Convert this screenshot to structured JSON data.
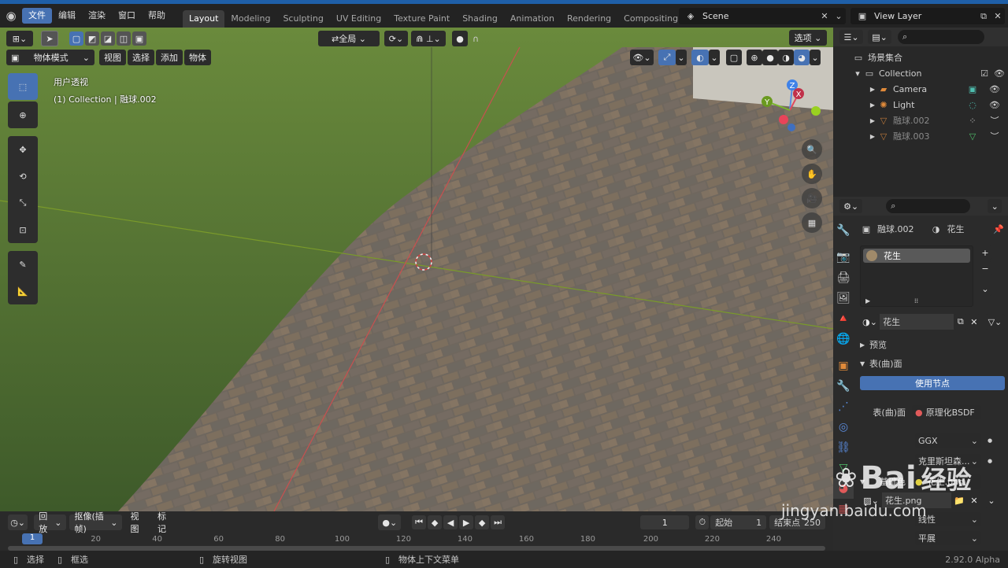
{
  "topbar": {
    "menu": [
      "文件",
      "编辑",
      "渲染",
      "窗口",
      "帮助"
    ],
    "workspaces": [
      "Layout",
      "Modeling",
      "Sculpting",
      "UV Editing",
      "Texture Paint",
      "Shading",
      "Animation",
      "Rendering",
      "Compositing"
    ],
    "scene": "Scene",
    "view_layer": "View Layer"
  },
  "viewport_header": {
    "transform_orientation": "全局",
    "options": "选项",
    "mode": "物体模式",
    "menus": [
      "视图",
      "选择",
      "添加",
      "物体"
    ]
  },
  "viewport": {
    "perspective": "用户透视",
    "collection_info": "(1) Collection | 融球.002",
    "axes": {
      "x": "X",
      "y": "Y",
      "z": "Z"
    }
  },
  "outliner": {
    "root": "场景集合",
    "items": [
      {
        "name": "Collection",
        "indent": 1
      },
      {
        "name": "Camera",
        "indent": 2
      },
      {
        "name": "Light",
        "indent": 2
      },
      {
        "name": "融球.002",
        "indent": 2,
        "dim": true
      },
      {
        "name": "融球.003",
        "indent": 2,
        "dim": true
      }
    ]
  },
  "properties": {
    "object": "融球.002",
    "material": "花生",
    "slot_material": "花生",
    "mat_selector": "花生",
    "panels": {
      "preview": "预览",
      "surface": "表(曲)面"
    },
    "use_nodes": "使用节点",
    "surface_label": "表(曲)面",
    "surface_value": "原理化BSDF",
    "distribution": "GGX",
    "subsurface": "克里斯坦森...",
    "base_color_label": "基础色",
    "base_color_value": "花生.png",
    "image_name": "花生.png",
    "interpolation": "线性",
    "projection": "平展"
  },
  "timeline": {
    "menus": [
      "回放",
      "抠像(插帧)",
      "视图",
      "标记"
    ],
    "current_frame": "1",
    "start_label": "起始",
    "start": "1",
    "end_label": "结束点",
    "end": "250",
    "ruler": [
      "1",
      "20",
      "40",
      "60",
      "80",
      "100",
      "120",
      "140",
      "160",
      "180",
      "200",
      "220",
      "240"
    ]
  },
  "statusbar": {
    "select": "选择",
    "box_select": "框选",
    "rotate_view": "旋转视图",
    "context_menu": "物体上下文菜单",
    "version": "2.92.0 Alpha"
  },
  "watermark": {
    "brand": "Bai",
    "brand2": "经验",
    "url": "jingyan.baidu.com"
  }
}
